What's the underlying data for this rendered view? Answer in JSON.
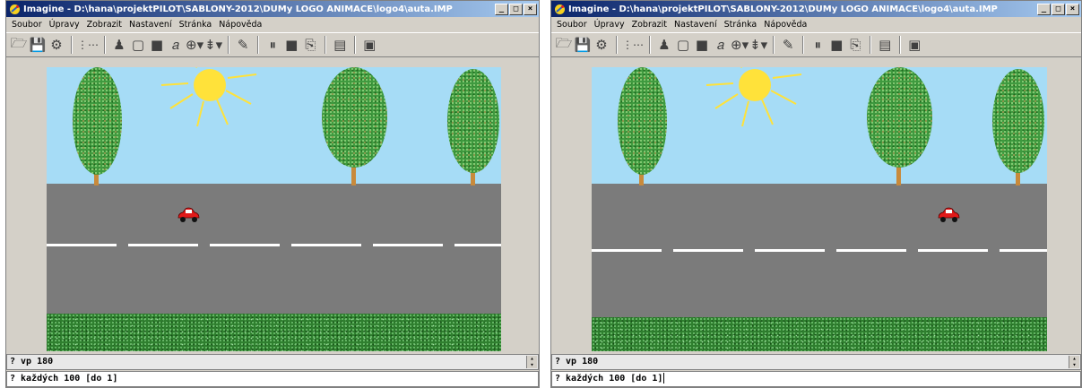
{
  "windows": [
    {
      "title": "Imagine - D:\\hana\\projektPILOT\\SABLONY-2012\\DUMy LOGO ANIMACE\\logo4\\auta.IMP",
      "menu": [
        "Soubor",
        "Úpravy",
        "Zobrazit",
        "Nastavení",
        "Stránka",
        "Nápověda"
      ],
      "history_line": "? vp 180",
      "command_line": "? každých 100 [do 1]",
      "car_position": 0.3
    },
    {
      "title": "Imagine - D:\\hana\\projektPILOT\\SABLONY-2012\\DUMy LOGO ANIMACE\\logo4\\auta.IMP",
      "menu": [
        "Soubor",
        "Úpravy",
        "Zobrazit",
        "Nastavení",
        "Stránka",
        "Nápověda"
      ],
      "history_line": "? vp 180",
      "command_line": "? každých 100 [do 1]",
      "car_position": 0.8
    }
  ],
  "window_buttons": {
    "minimize": "_",
    "maximize": "□",
    "close": "×"
  },
  "toolbar_icons": [
    "open-icon",
    "save-icon",
    "print-icon",
    "turtle-grid-icon",
    "turtle-icon",
    "rectangle-icon",
    "filled-rectangle-icon",
    "text-icon",
    "joystick-icon",
    "slider-icon",
    "eraser-icon",
    "pause-icon",
    "stop-icon",
    "step-icon",
    "page-icon",
    "panel-icon"
  ],
  "colors": {
    "title_bar_start": "#0a246a",
    "title_bar_end": "#a6caf0",
    "sky": "#a6dcf6",
    "road": "#7b7b7b",
    "lane_marking": "#ffffff",
    "grass": "#2f7f2f",
    "sun": "#ffe23a",
    "car": "#e11a1a",
    "trunk": "#c88a3c"
  }
}
